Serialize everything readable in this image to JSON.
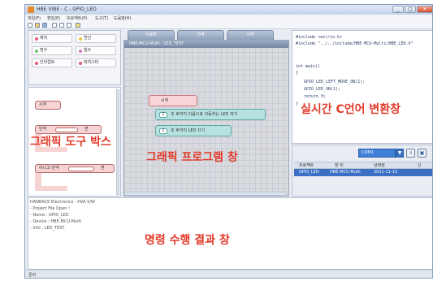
{
  "window": {
    "title": "HBE VIBE - C - GPIO_LED",
    "controls": [
      "_",
      "□",
      "✕"
    ]
  },
  "menu": [
    "파일(F)",
    "편집(E)",
    "프로젝트(P)",
    "도구(T)",
    "도움말(H)"
  ],
  "palette": {
    "categories": [
      {
        "label": "제어",
        "color": "#e6577a"
      },
      {
        "label": "연산",
        "color": "#e8c03b"
      },
      {
        "label": "변수",
        "color": "#6cc66a"
      },
      {
        "label": "함수",
        "color": "#d873c9"
      },
      {
        "label": "인터럽트",
        "color": "#e5567b"
      },
      {
        "label": "레지스터",
        "color": "#e5567b"
      }
    ]
  },
  "block_box": {
    "blocks": [
      {
        "label": "시작"
      },
      {
        "label": "만약",
        "right": "면"
      },
      {
        "label": "아니고 만약",
        "right": "면"
      }
    ]
  },
  "canvas": {
    "tabs": [
      "사용자",
      "전역",
      "시작"
    ],
    "title": "HBE-MCU-Multi : LED_TEST",
    "blocks": [
      {
        "label": "시작"
      },
      {
        "num": "1",
        "label": "초 후까지 다음으로 이동하는 LED 켜기"
      },
      {
        "num": "1",
        "label": "초 후까지 LED 끄기"
      }
    ]
  },
  "code": {
    "lines": [
      "#include <avr/io.h>",
      "#include \"../../include/HBE-MCU-Multi/HBE_LED.h\"",
      "",
      "int main()",
      "{",
      "GPIO_LED_LEFT_MOVE_ON(1);",
      "GPIO_LED_ON(1);",
      "return 0;",
      "}"
    ]
  },
  "device_panel": {
    "selected_port": "COM1",
    "headers": [
      "프로젝트",
      "장 비",
      "상태정",
      "신"
    ],
    "row": [
      "GPIO_LED",
      "HBE-MCU-Multi",
      "2011-11-13",
      ""
    ]
  },
  "output": {
    "lines": [
      "HANBACK Electronics - HVA S/W",
      "- Project File Open !",
      "  - Name : GPIO_LED",
      "  - Device : HBE-MCU-Multi",
      "  - Info : LED_TEST"
    ]
  },
  "status_bar": {
    "text": "준비"
  },
  "annotations": {
    "code_view": "실시간 C언어 변환창",
    "block_box": "그래픽 도구 박스",
    "canvas": "그래픽 프로그램 창",
    "output": "명령 수행 결과 창"
  }
}
